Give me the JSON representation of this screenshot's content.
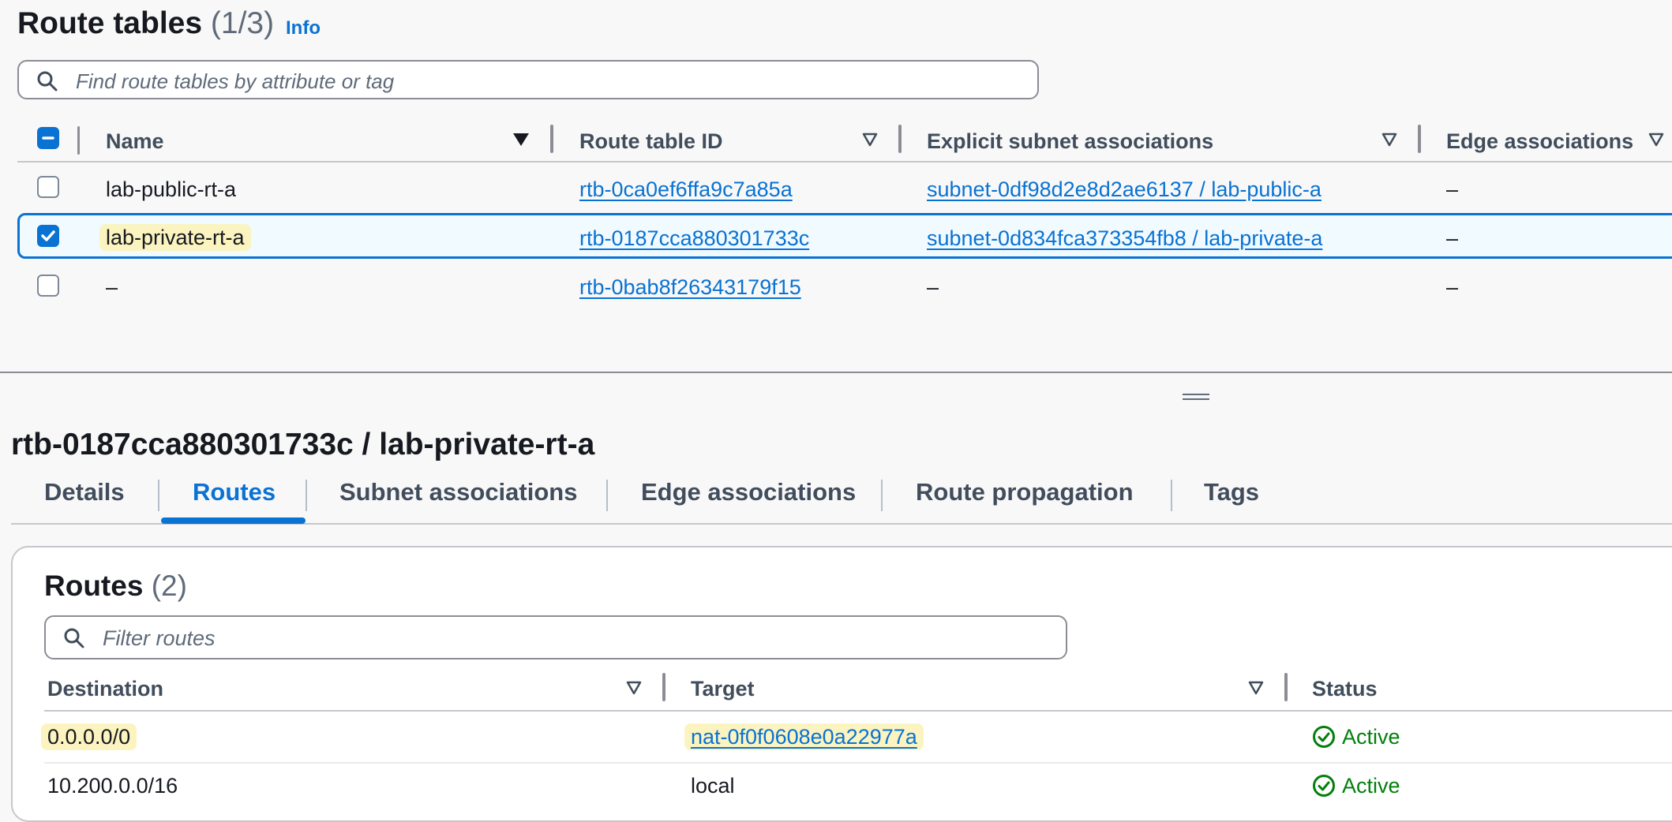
{
  "route_tables": {
    "title": "Route tables",
    "count": "(1/3)",
    "info_link": "Info",
    "search_placeholder": "Find route tables by attribute or tag",
    "columns": [
      "Name",
      "Route table ID",
      "Explicit subnet associations",
      "Edge associations"
    ],
    "rows": [
      {
        "name": "lab-public-rt-a",
        "id": "rtb-0ca0ef6ffa9c7a85a",
        "subnet": "subnet-0df98d2e8d2ae6137 / lab-public-a",
        "edge": "–",
        "selected": false
      },
      {
        "name": "lab-private-rt-a",
        "id": "rtb-0187cca880301733c",
        "subnet": "subnet-0d834fca373354fb8 / lab-private-a",
        "edge": "–",
        "selected": true
      },
      {
        "name": "–",
        "id": "rtb-0bab8f26343179f15",
        "subnet": "–",
        "edge": "–",
        "selected": false
      }
    ]
  },
  "detail": {
    "title": "rtb-0187cca880301733c / lab-private-rt-a",
    "tabs": [
      "Details",
      "Routes",
      "Subnet associations",
      "Edge associations",
      "Route propagation",
      "Tags"
    ],
    "active_tab": "Routes"
  },
  "routes": {
    "title": "Routes",
    "count": "(2)",
    "search_placeholder": "Filter routes",
    "columns": [
      "Destination",
      "Target",
      "Status"
    ],
    "rows": [
      {
        "destination": "0.0.0.0/0",
        "target": "nat-0f0f0608e0a22977a",
        "status": "Active"
      },
      {
        "destination": "10.200.0.0/16",
        "target": "local",
        "status": "Active"
      }
    ]
  },
  "colors": {
    "accent": "#0972d3",
    "success": "#037f0c",
    "highlight": "#fbf4c0"
  }
}
